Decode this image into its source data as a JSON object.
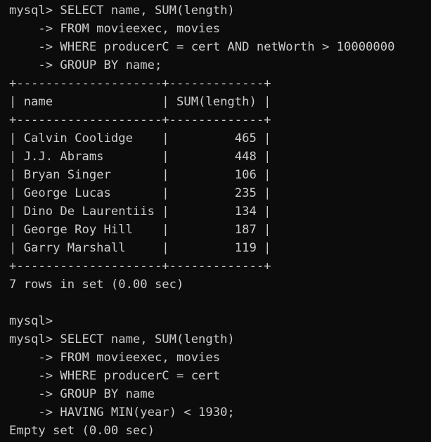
{
  "terminal": {
    "lines": [
      "mysql> SELECT name, SUM(length)",
      "    -> FROM movieexec, movies",
      "    -> WHERE producerC = cert AND netWorth > 10000000",
      "    -> GROUP BY name;",
      "+--------------------+-------------+",
      "| name               | SUM(length) |",
      "+--------------------+-------------+",
      "| Calvin Coolidge    |         465 |",
      "| J.J. Abrams        |         448 |",
      "| Bryan Singer       |         106 |",
      "| George Lucas       |         235 |",
      "| Dino De Laurentiis |         134 |",
      "| George Roy Hill    |         187 |",
      "| Garry Marshall     |         119 |",
      "+--------------------+-------------+",
      "7 rows in set (0.00 sec)",
      "",
      "mysql>",
      "mysql> SELECT name, SUM(length)",
      "    -> FROM movieexec, movies",
      "    -> WHERE producerC = cert",
      "    -> GROUP BY name",
      "    -> HAVING MIN(year) < 1930;",
      "Empty set (0.00 sec)"
    ]
  }
}
